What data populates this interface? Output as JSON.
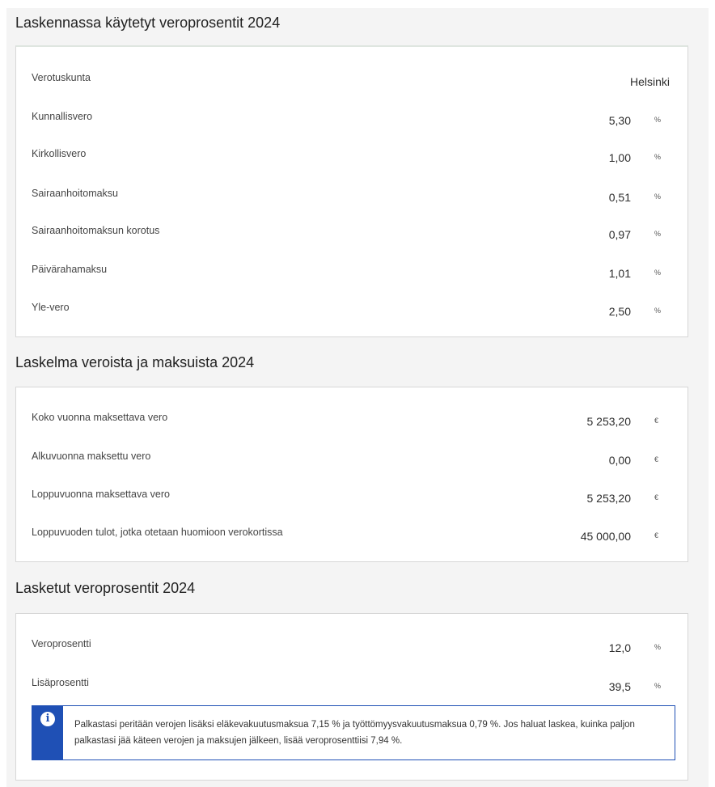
{
  "rates_section": {
    "title": "Laskennassa käytetyt veroprosentit 2024",
    "municipality_label": "Verotuskunta",
    "municipality_value": "Helsinki",
    "rows": [
      {
        "label": "Kunnallisvero",
        "value": "5,30",
        "unit": "%"
      },
      {
        "label": "Kirkollisvero",
        "value": "1,00",
        "unit": "%"
      },
      {
        "label": "Sairaanhoitomaksu",
        "value": "0,51",
        "unit": "%"
      },
      {
        "label": "Sairaanhoitomaksun korotus",
        "value": "0,97",
        "unit": "%"
      },
      {
        "label": "Päivärahamaksu",
        "value": "1,01",
        "unit": "%"
      },
      {
        "label": "Yle-vero",
        "value": "2,50",
        "unit": "%"
      }
    ]
  },
  "calc_section": {
    "title": "Laskelma veroista ja maksuista 2024",
    "rows": [
      {
        "label": "Koko vuonna maksettava vero",
        "value": "5 253,20",
        "unit": "€"
      },
      {
        "label": "Alkuvuonna maksettu vero",
        "value": "0,00",
        "unit": "€"
      },
      {
        "label": "Loppuvuonna maksettava vero",
        "value": "5 253,20",
        "unit": "€"
      },
      {
        "label": "Loppuvuoden tulot, jotka otetaan huomioon verokortissa",
        "value": "45 000,00",
        "unit": "€"
      }
    ]
  },
  "result_section": {
    "title": "Lasketut veroprosentit 2024",
    "rows": [
      {
        "label": "Veroprosentti",
        "value": "12,0",
        "unit": "%"
      },
      {
        "label": "Lisäprosentti",
        "value": "39,5",
        "unit": "%"
      }
    ],
    "info_icon": "info-icon",
    "info_text": "Palkastasi peritään verojen lisäksi eläkevakuutusmaksua 7,15 % ja työttömyysvakuutusmaksua 0,79 %. Jos haluat laskea, kuinka paljon palkastasi jää käteen verojen ja maksujen jälkeen, lisää veroprosenttiisi 7,94 %."
  },
  "colors": {
    "info_accent": "#1f50b5",
    "page_background": "#f4f4f4"
  }
}
